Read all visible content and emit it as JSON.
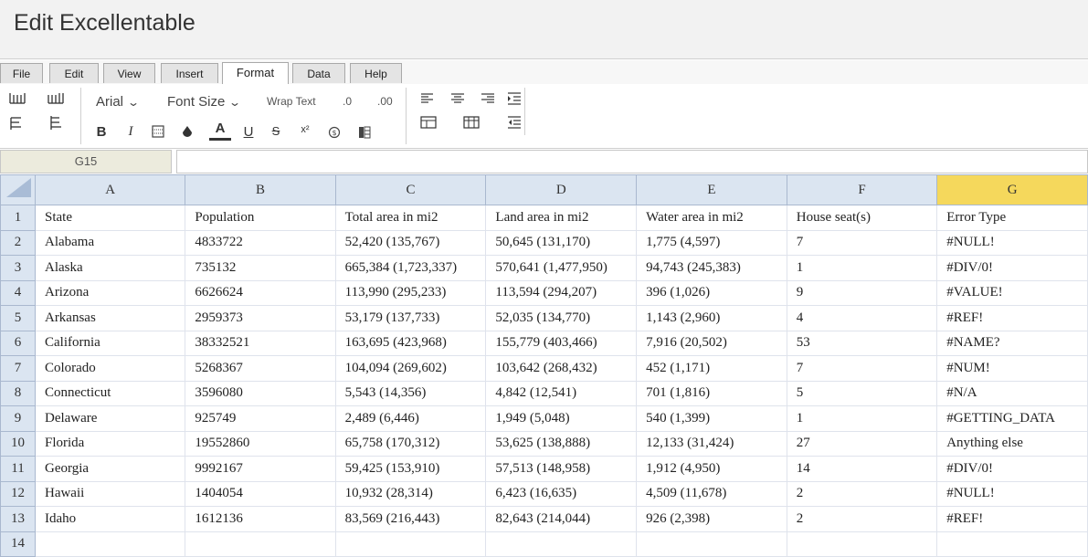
{
  "app": {
    "title": "Edit Excellentable"
  },
  "tabs": [
    "File",
    "Edit",
    "View",
    "Insert",
    "Format",
    "Data",
    "Help"
  ],
  "active_tab": "Format",
  "toolbar": {
    "font_family": "Arial",
    "font_size": "Font Size",
    "wrap_text": "Wrap Text",
    "decimal_decrease": ".0",
    "decimal_increase": ".00",
    "bold": "B",
    "italic": "I",
    "font_color": "A",
    "underline": "U",
    "strikethrough": "S",
    "superscript": "x²"
  },
  "formula_bar": {
    "cell_ref": "G15",
    "value": ""
  },
  "sheet": {
    "columns": [
      "A",
      "B",
      "C",
      "D",
      "E",
      "F",
      "G"
    ],
    "selected_column": "G",
    "rows": [
      {
        "num": "1",
        "cells": [
          "State",
          "Population",
          "Total area in mi2",
          "Land area in mi2",
          "Water area in mi2",
          "House seat(s)",
          "Error Type"
        ]
      },
      {
        "num": "2",
        "cells": [
          "Alabama",
          "4833722",
          "52,420 (135,767)",
          "50,645 (131,170)",
          "1,775 (4,597)",
          "7",
          "#NULL!"
        ]
      },
      {
        "num": "3",
        "cells": [
          "Alaska",
          "735132",
          "665,384 (1,723,337)",
          "570,641 (1,477,950)",
          "94,743 (245,383)",
          "1",
          "#DIV/0!"
        ]
      },
      {
        "num": "4",
        "cells": [
          "Arizona",
          "6626624",
          "113,990 (295,233)",
          "113,594 (294,207)",
          "396 (1,026)",
          "9",
          "#VALUE!"
        ]
      },
      {
        "num": "5",
        "cells": [
          "Arkansas",
          "2959373",
          "53,179 (137,733)",
          "52,035 (134,770)",
          "1,143 (2,960)",
          "4",
          "#REF!"
        ]
      },
      {
        "num": "6",
        "cells": [
          "California",
          "38332521",
          "163,695 (423,968)",
          "155,779 (403,466)",
          "7,916 (20,502)",
          "53",
          "#NAME?"
        ]
      },
      {
        "num": "7",
        "cells": [
          "Colorado",
          "5268367",
          "104,094 (269,602)",
          "103,642 (268,432)",
          "452 (1,171)",
          "7",
          "#NUM!"
        ]
      },
      {
        "num": "8",
        "cells": [
          "Connecticut",
          "3596080",
          "5,543 (14,356)",
          "4,842 (12,541)",
          "701 (1,816)",
          "5",
          "#N/A"
        ]
      },
      {
        "num": "9",
        "cells": [
          "Delaware",
          "925749",
          "2,489 (6,446)",
          "1,949 (5,048)",
          "540 (1,399)",
          "1",
          "#GETTING_DATA"
        ]
      },
      {
        "num": "10",
        "cells": [
          "Florida",
          "19552860",
          "65,758 (170,312)",
          "53,625 (138,888)",
          "12,133 (31,424)",
          "27",
          "Anything else"
        ]
      },
      {
        "num": "11",
        "cells": [
          "Georgia",
          "9992167",
          "59,425 (153,910)",
          "57,513 (148,958)",
          "1,912 (4,950)",
          "14",
          "#DIV/0!"
        ]
      },
      {
        "num": "12",
        "cells": [
          "Hawaii",
          "1404054",
          "10,932 (28,314)",
          "6,423 (16,635)",
          "4,509 (11,678)",
          "2",
          "#NULL!"
        ]
      },
      {
        "num": "13",
        "cells": [
          "Idaho",
          "1612136",
          "83,569 (216,443)",
          "82,643 (214,044)",
          "926 (2,398)",
          "2",
          "#REF!"
        ]
      },
      {
        "num": "14",
        "cells": [
          "",
          "",
          "",
          "",
          "",
          "",
          ""
        ]
      }
    ]
  }
}
